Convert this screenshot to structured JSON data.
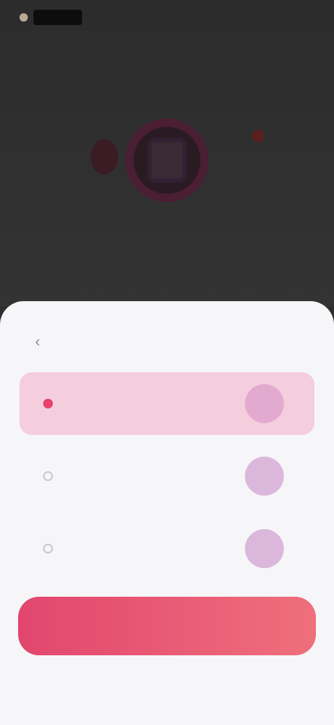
{
  "status_bar": {
    "time": ""
  },
  "hero": {
    "title": ""
  },
  "sheet": {
    "title": "",
    "back_icon": "chevron-left-icon",
    "options": [
      {
        "name": "",
        "description": "",
        "selected": true
      },
      {
        "name": "",
        "description": "",
        "selected": false
      },
      {
        "name": "",
        "description": "",
        "selected": false
      }
    ],
    "continue_label": "",
    "footer_left": "",
    "footer_right": ""
  },
  "colors": {
    "accent": "#e8416e",
    "selected_bg": "#f5cedd",
    "sheet_bg": "#f6f6f8",
    "dark_bg": "#2e2e2e"
  }
}
